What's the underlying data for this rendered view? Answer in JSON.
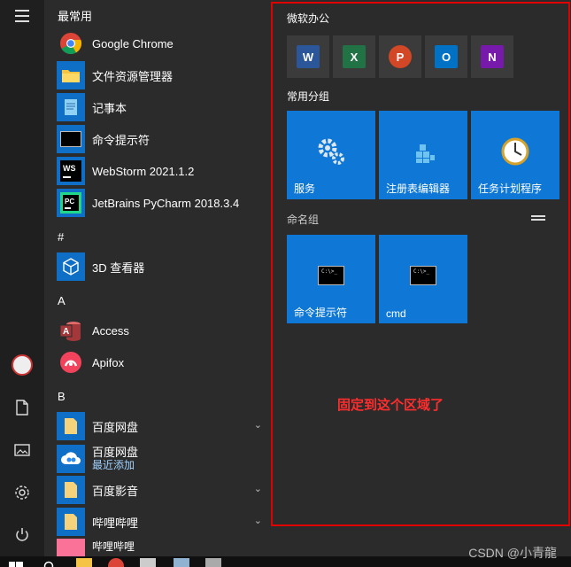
{
  "sections": {
    "most_used": "最常用",
    "hash": "#",
    "a": "A",
    "b": "B"
  },
  "apps": [
    {
      "label": "Google Chrome"
    },
    {
      "label": "文件资源管理器"
    },
    {
      "label": "记事本"
    },
    {
      "label": "命令提示符"
    },
    {
      "label": "WebStorm 2021.1.2"
    },
    {
      "label": "JetBrains PyCharm 2018.3.4"
    },
    {
      "label": "3D 查看器"
    },
    {
      "label": "Access"
    },
    {
      "label": "Apifox"
    },
    {
      "label": "百度网盘"
    },
    {
      "label": "百度网盘",
      "sub": "最近添加"
    },
    {
      "label": "百度影音"
    },
    {
      "label": "哔哩哔哩"
    },
    {
      "label": "哔哩哔哩"
    }
  ],
  "tiles": {
    "group1_title": "微软办公",
    "office": [
      "W",
      "X",
      "P",
      "O",
      "N"
    ],
    "group2_title": "常用分组",
    "common": [
      {
        "label": "服务"
      },
      {
        "label": "注册表编辑器"
      },
      {
        "label": "任务计划程序"
      }
    ],
    "group3_title": "命名组",
    "named": [
      {
        "label": "命令提示符"
      },
      {
        "label": "cmd"
      }
    ],
    "note": "固定到这个区域了"
  },
  "cmd_text": "C:\\>_",
  "watermark": "CSDN @小青龍",
  "colors": {
    "accent": "#0f78d7",
    "annotation": "#e00000"
  }
}
